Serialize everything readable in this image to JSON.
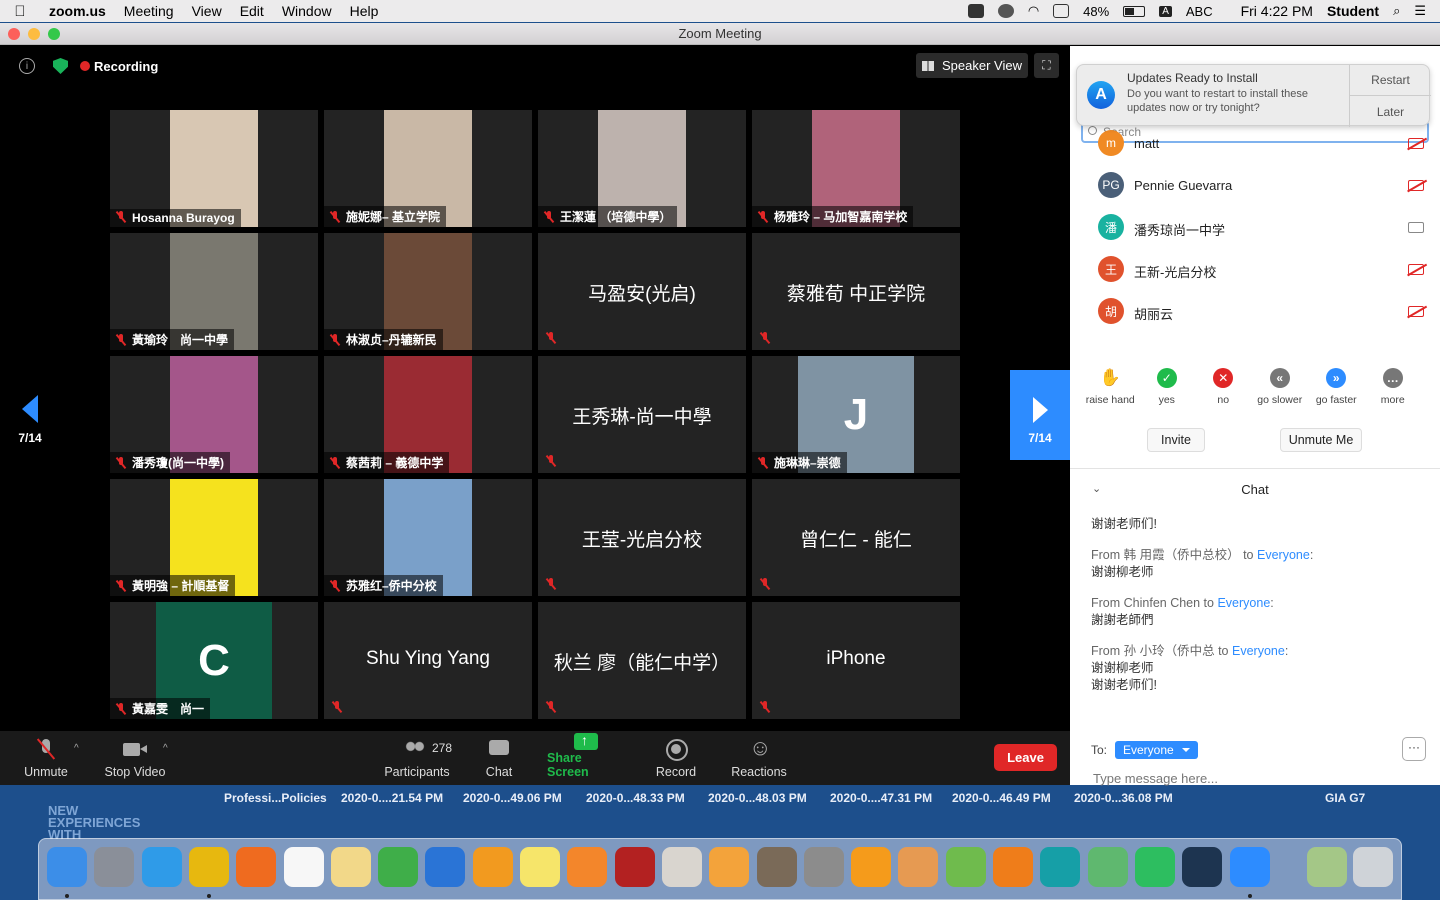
{
  "menubar": {
    "app": "zoom.us",
    "menus": [
      "Meeting",
      "View",
      "Edit",
      "Window",
      "Help"
    ],
    "battery": "48%",
    "input": "ABC",
    "clock": "Fri 4:22 PM",
    "user": "Student"
  },
  "window": {
    "title": "Zoom Meeting"
  },
  "topbar": {
    "recording": "Recording",
    "speaker_view": "Speaker View"
  },
  "gallery": {
    "page": "7/14",
    "tiles": [
      {
        "name": "Hosanna Burayog",
        "video": true,
        "bg": "#d8c7b3"
      },
      {
        "name": "施妮娜– 基立学院",
        "video": true,
        "bg": "#c9b8a6"
      },
      {
        "name": "王潔蓮 （培德中學）",
        "video": true,
        "bg": "#bdb2ad"
      },
      {
        "name": "杨雅玲 – 马加智嘉南学校",
        "video": true,
        "bg": "#b0637a"
      },
      {
        "name": "黃瑜玲　尚一中學",
        "video": true,
        "bg": "#7a786f"
      },
      {
        "name": "林淑贞–丹辘新民",
        "video": true,
        "bg": "#6b4a38"
      },
      {
        "name": "马盈安(光启)",
        "video": false
      },
      {
        "name": "蔡雅荀 中正学院",
        "video": false
      },
      {
        "name": "潘秀瓊(尚一中學)",
        "video": true,
        "bg": "#a4568a"
      },
      {
        "name": "蔡茜莉 – 義德中学",
        "video": true,
        "bg": "#9a2b33"
      },
      {
        "name": "王秀琳-尚一中學",
        "video": false
      },
      {
        "name": "施琳琳–崇德",
        "video": false,
        "letter": "J",
        "letter_bg": "#7f93a3"
      },
      {
        "name": "黃明強 – 計順基督",
        "video": true,
        "bg": "#f5e21e"
      },
      {
        "name": "苏雅红–侨中分校",
        "video": true,
        "bg": "#7aa0c9"
      },
      {
        "name": "王莹-光启分校",
        "video": false
      },
      {
        "name": "曾仁仁 - 能仁",
        "video": false
      },
      {
        "name": "黃嘉雯　尚一",
        "video": false,
        "letter": "C",
        "letter_bg": "#0f5c45"
      },
      {
        "name": "Shu Ying  Yang",
        "video": false
      },
      {
        "name": "秋兰 廖（能仁中学）",
        "video": false
      },
      {
        "name": "iPhone",
        "video": false
      }
    ]
  },
  "toolbar": {
    "unmute": "Unmute",
    "stop_video": "Stop Video",
    "participants": "Participants",
    "participant_count": "278",
    "chat": "Chat",
    "share_screen": "Share Screen",
    "record": "Record",
    "reactions": "Reactions",
    "leave": "Leave"
  },
  "notification": {
    "title": "Updates Ready to Install",
    "body": "Do you want to restart to install these updates now or try tonight?",
    "restart": "Restart",
    "later": "Later"
  },
  "panel": {
    "search_placeholder": "Search",
    "participants": [
      {
        "initials": "m",
        "name": "matt",
        "color": "#f08a24",
        "video": false
      },
      {
        "initials": "PG",
        "name": "Pennie Guevarra",
        "color": "#4a5f78",
        "video": false
      },
      {
        "initials": "潘",
        "name": "潘秀琼尚一中学",
        "color": "#19b2a0",
        "video": true
      },
      {
        "initials": "王",
        "name": "王新-光启分校",
        "color": "#e0522d",
        "video": false
      },
      {
        "initials": "胡",
        "name": "胡丽云",
        "color": "#e0522d",
        "video": false
      }
    ],
    "feedback": [
      {
        "label": "raise hand",
        "icon": "raise-hand-icon",
        "color": "#2d8cff"
      },
      {
        "label": "yes",
        "icon": "check-icon",
        "color": "#1fbb4b"
      },
      {
        "label": "no",
        "icon": "x-icon",
        "color": "#e02727"
      },
      {
        "label": "go slower",
        "icon": "rewind-icon",
        "color": "#777"
      },
      {
        "label": "go faster",
        "icon": "fast-forward-icon",
        "color": "#2d8cff"
      },
      {
        "label": "more",
        "icon": "more-icon",
        "color": "#777"
      }
    ],
    "invite": "Invite",
    "unmute_me": "Unmute Me",
    "chat_title": "Chat",
    "messages": [
      {
        "from": "",
        "to": "",
        "lines": [
          "谢谢老师们!"
        ]
      },
      {
        "from": "From 韩 用霞（侨中总校） to",
        "to": "Everyone",
        "lines": [
          "谢谢柳老师"
        ]
      },
      {
        "from": "From Chinfen Chen to",
        "to": "Everyone",
        "lines": [
          "謝謝老師們"
        ]
      },
      {
        "from": "From 孙 小玲（侨中总 to",
        "to": "Everyone",
        "lines": [
          "谢谢柳老师",
          "谢谢老师们!"
        ]
      }
    ],
    "to_label": "To:",
    "to_value": "Everyone",
    "message_placeholder": "Type message here..."
  },
  "desktop": {
    "labels": [
      "Professi...Policies",
      "2020-0....21.54 PM",
      "2020-0...49.06 PM",
      "2020-0...48.33 PM",
      "2020-0...48.03 PM",
      "2020-0....47.31 PM",
      "2020-0...46.49 PM",
      "2020-0...36.08 PM",
      "GIA G7"
    ],
    "brand_lines": [
      "NEW",
      "EXPERIENCES",
      "WITH"
    ]
  },
  "dock": {
    "apps": [
      {
        "name": "finder-icon",
        "color": "#3c8ee8"
      },
      {
        "name": "launchpad-icon",
        "color": "#8a8f99"
      },
      {
        "name": "safari-icon",
        "color": "#2f9be8"
      },
      {
        "name": "chrome-icon",
        "color": "#e7b80f"
      },
      {
        "name": "firefox-icon",
        "color": "#ef6b1f"
      },
      {
        "name": "calendar-icon",
        "color": "#f7f7f7"
      },
      {
        "name": "notes-pad-icon",
        "color": "#f2d889"
      },
      {
        "name": "numbers-icon",
        "color": "#3fae49"
      },
      {
        "name": "keynote-icon",
        "color": "#2a74d6"
      },
      {
        "name": "books-icon",
        "color": "#f29a1f"
      },
      {
        "name": "stickies-icon",
        "color": "#f6e56a"
      },
      {
        "name": "pages-icon",
        "color": "#f3862b"
      },
      {
        "name": "photo-booth-icon",
        "color": "#b32121"
      },
      {
        "name": "sketch-icon",
        "color": "#d9d5cf"
      },
      {
        "name": "scratch-icon",
        "color": "#f3a33b"
      },
      {
        "name": "gimp-icon",
        "color": "#7a6a58"
      },
      {
        "name": "system-prefs-icon",
        "color": "#8c8c8c"
      },
      {
        "name": "moodle-icon",
        "color": "#f59b1b"
      },
      {
        "name": "folder-icon",
        "color": "#e69a52"
      },
      {
        "name": "maps-icon",
        "color": "#6fbb4d"
      },
      {
        "name": "blender-icon",
        "color": "#ef7d1a"
      },
      {
        "name": "arduino-icon",
        "color": "#169fa7"
      },
      {
        "name": "atom-icon",
        "color": "#5fb86f"
      },
      {
        "name": "evernote-icon",
        "color": "#2dbe60"
      },
      {
        "name": "vectorworks-icon",
        "color": "#1d3450"
      },
      {
        "name": "zoom-icon",
        "color": "#2d8cff"
      },
      {
        "name": "preview-icon",
        "color": "#a4c787"
      },
      {
        "name": "trash-icon",
        "color": "#cfd3d8"
      }
    ]
  }
}
